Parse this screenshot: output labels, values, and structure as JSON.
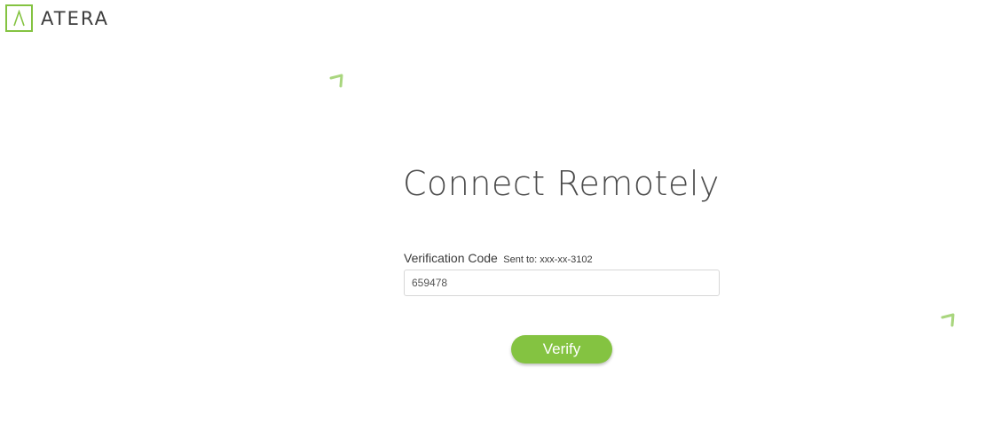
{
  "brand": {
    "name": "ATERA",
    "accent_color": "#84c341",
    "logo_icon": "atera-logo-icon"
  },
  "main": {
    "title": "Connect Remotely",
    "verification": {
      "label": "Verification Code",
      "sent_to": "Sent to: xxx-xx-3102",
      "value": "659478",
      "placeholder": ""
    },
    "verify_button": {
      "label": "Verify"
    }
  }
}
